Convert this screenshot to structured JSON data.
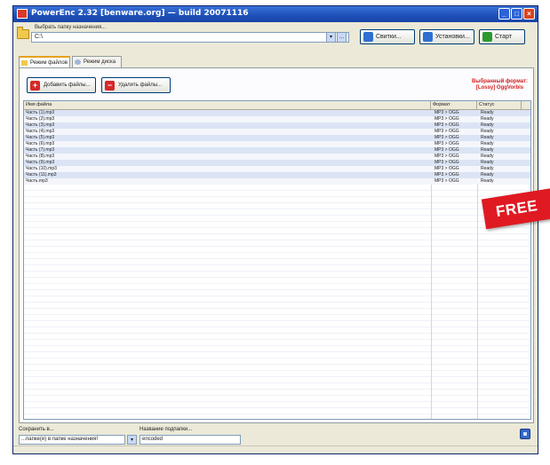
{
  "window": {
    "title": "PowerEnc 2.32 [benware.org] — build 20071116",
    "minimize_symbol": "_",
    "maximize_symbol": "□",
    "close_symbol": "×"
  },
  "toolbar": {
    "folder_label": "Выбрать папку назначения...",
    "path_value": "C:\\",
    "combo_symbol": "▾",
    "browse_symbol": "...",
    "buttons": [
      {
        "label": "Свитки...",
        "icon": "refresh-icon",
        "color": "#2f6fd2"
      },
      {
        "label": "Установки...",
        "icon": "settings-icon",
        "color": "#2f6fd2"
      },
      {
        "label": "Старт",
        "icon": "start-icon",
        "color": "#2e9a2e"
      }
    ]
  },
  "tabs": [
    {
      "label": "Режим файлов",
      "active": true,
      "icon": "folder-icon"
    },
    {
      "label": "Режим диска",
      "active": false,
      "icon": "disk-icon"
    }
  ],
  "actions": {
    "add_label": "Добавить файлы...",
    "remove_label": "Удалить файлы...",
    "add_symbol": "+",
    "remove_symbol": "−"
  },
  "format_info": {
    "line1": "Выбранный формат:",
    "line2": "[Lossy] OggVorbis",
    "color": "#d31f1f"
  },
  "table": {
    "columns": [
      "Имя файла",
      "Формат",
      "Статус"
    ],
    "rows": [
      {
        "name": "Часть (1).mp3",
        "format": "MP3 > OGG",
        "status": "Ready"
      },
      {
        "name": "Часть (2).mp3",
        "format": "MP3 > OGG",
        "status": "Ready"
      },
      {
        "name": "Часть (3).mp3",
        "format": "MP3 > OGG",
        "status": "Ready"
      },
      {
        "name": "Часть (4).mp3",
        "format": "MP3 > OGG",
        "status": "Ready"
      },
      {
        "name": "Часть (5).mp3",
        "format": "MP3 > OGG",
        "status": "Ready"
      },
      {
        "name": "Часть (6).mp3",
        "format": "MP3 > OGG",
        "status": "Ready"
      },
      {
        "name": "Часть (7).mp3",
        "format": "MP3 > OGG",
        "status": "Ready"
      },
      {
        "name": "Часть (8).mp3",
        "format": "MP3 > OGG",
        "status": "Ready"
      },
      {
        "name": "Часть (9).mp3",
        "format": "MP3 > OGG",
        "status": "Ready"
      },
      {
        "name": "Часть (10).mp3",
        "format": "MP3 > OGG",
        "status": "Ready"
      },
      {
        "name": "Часть (11).mp3",
        "format": "MP3 > OGG",
        "status": "Ready"
      },
      {
        "name": "Часть.mp3",
        "format": "MP3 > OGG",
        "status": "Ready"
      }
    ]
  },
  "badge": {
    "text": "FREE",
    "color": "#e01a22"
  },
  "bottom": {
    "save_label": "Сохранить в...",
    "save_value": "...папке(и) в папке назначения!",
    "subfolder_label": "Название подпапки...",
    "subfolder_value": "encoded",
    "combo_symbol": "▾"
  }
}
